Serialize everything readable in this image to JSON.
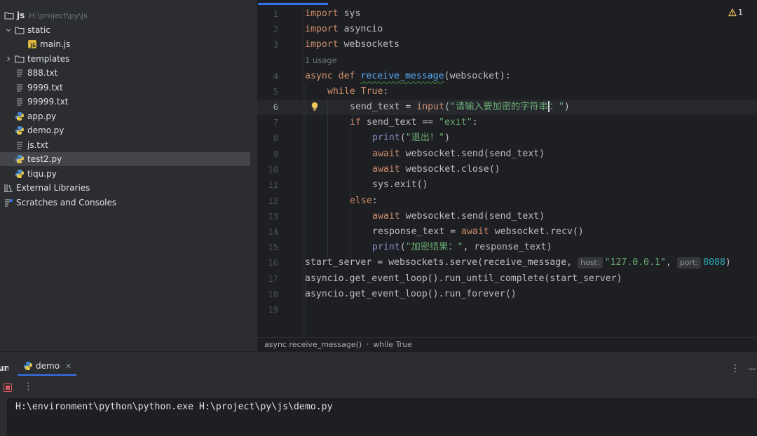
{
  "project": {
    "root_name": "js",
    "root_path": "H:\\project\\py\\js",
    "items": [
      {
        "label": "static",
        "type": "folder",
        "depth": 1,
        "expanded": true
      },
      {
        "label": "main.js",
        "type": "js",
        "depth": 2
      },
      {
        "label": "templates",
        "type": "folder",
        "depth": 1,
        "expanded": false
      },
      {
        "label": "888.txt",
        "type": "txt",
        "depth": 1
      },
      {
        "label": "9999.txt",
        "type": "txt",
        "depth": 1
      },
      {
        "label": "99999.txt",
        "type": "txt",
        "depth": 1
      },
      {
        "label": "app.py",
        "type": "py",
        "depth": 1
      },
      {
        "label": "demo.py",
        "type": "py",
        "depth": 1
      },
      {
        "label": "js.txt",
        "type": "txt",
        "depth": 1
      },
      {
        "label": "test2.py",
        "type": "py",
        "depth": 1,
        "selected": true
      },
      {
        "label": "tiqu.py",
        "type": "py",
        "depth": 1
      }
    ],
    "external_libraries": "External Libraries",
    "scratches": "Scratches and Consoles"
  },
  "editor": {
    "warning_count": "1",
    "usage_hint": "1 usage",
    "current_line": 6,
    "line_numbers": [
      "1",
      "2",
      "3",
      "4",
      "5",
      "6",
      "7",
      "8",
      "9",
      "10",
      "11",
      "12",
      "13",
      "14",
      "15",
      "16",
      "17",
      "18",
      "19"
    ],
    "code": {
      "l1_kw": "import",
      "l1_rest": " sys",
      "l2_kw": "import",
      "l2_rest": " asyncio",
      "l3_kw": "import",
      "l3_rest": " websockets",
      "l4_kw": "async def",
      "l4_fn": "receive_message",
      "l4_rest": "(websocket):",
      "l5_kw": "while",
      "l5_true": "True",
      "l5_rest": ":",
      "l6_a": "send_text = ",
      "l6_fn": "input",
      "l6_p": "(",
      "l6_str": "\"请输入要加密的字符串",
      "l6_str2": "：\"",
      "l6_end": ")",
      "l7_kw": "if",
      "l7_rest": " send_text == ",
      "l7_str": "\"exit\"",
      "l7_end": ":",
      "l8_fn": "print",
      "l8_p": "(",
      "l8_str": "\"退出！\"",
      "l8_end": ")",
      "l9_kw": "await",
      "l9_rest": " websocket.send(send_text)",
      "l10_kw": "await",
      "l10_rest": " websocket.close()",
      "l11_rest": "sys.exit()",
      "l12_kw": "else",
      "l12_rest": ":",
      "l13_kw": "await",
      "l13_rest": " websocket.send(send_text)",
      "l14_a": "response_text = ",
      "l14_kw": "await",
      "l14_rest": " websocket.recv()",
      "l15_fn": "print",
      "l15_p": "(",
      "l15_str": "\"加密结果：\"",
      "l15_rest": ", response_text)",
      "l16_a": "start_server = websockets.serve(receive_message,",
      "l16_hint_host": "host:",
      "l16_host": "\"127.0.0.1\"",
      "l16_comma": ",",
      "l16_hint_port": "port:",
      "l16_port": "8088",
      "l16_end": ")",
      "l17": "asyncio.get_event_loop().run_until_complete(start_server)",
      "l18": "asyncio.get_event_loop().run_forever()"
    }
  },
  "breadcrumb": [
    "async receive_message()",
    "while True"
  ],
  "run": {
    "title": "Run",
    "tab_label": "demo",
    "console_line": "H:\\environment\\python\\python.exe H:\\project\\py\\js\\demo.py"
  },
  "colors": {
    "keyword": "#cf8e6d",
    "function_def": "#56a8f5",
    "string": "#6aab73",
    "number": "#2aacb8",
    "accent": "#3574f0",
    "stop": "#db5c5c"
  }
}
